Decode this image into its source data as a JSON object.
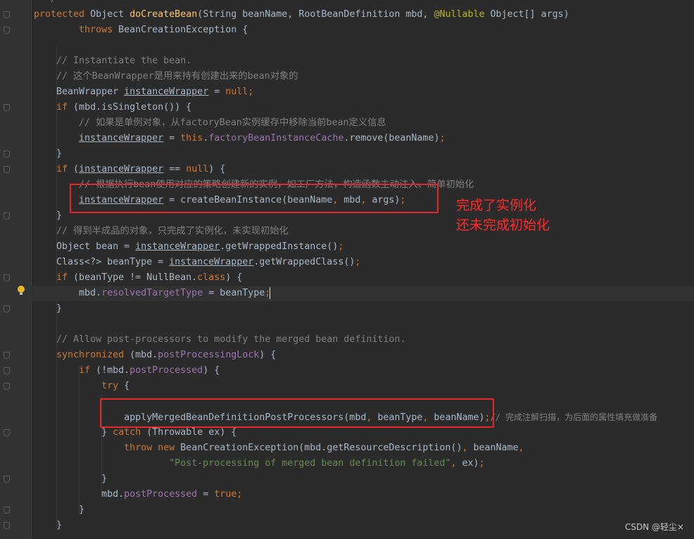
{
  "code": {
    "l0": "*/",
    "l1": [
      "protected",
      "Object",
      "doCreateBean",
      "(String beanName, RootBeanDefinition mbd, ",
      "@Nullable",
      " Object[] args)"
    ],
    "l2": [
      "throws",
      "BeanCreationException {"
    ],
    "l4": "// Instantiate the bean.",
    "l5": "// 这个BeanWrapper是用来持有创建出来的bean对象的",
    "l6": [
      "BeanWrapper ",
      "instanceWrapper",
      " = ",
      "null",
      ";"
    ],
    "l7": [
      "if",
      " (mbd.isSingleton()) {"
    ],
    "l8": "// 如果是单例对象，从factoryBean实例缓存中移除当前bean定义信息",
    "l9": [
      "instanceWrapper",
      " = ",
      "this",
      ".",
      "factoryBeanInstanceCache",
      ".remove(beanName)",
      ";"
    ],
    "l10": "}",
    "l11": [
      "if",
      " (",
      "instanceWrapper",
      " == ",
      "null",
      ") {"
    ],
    "l12": "// 根据执行bean使用对应的策略创建新的实例，如工厂方法，构造函数主动注入、简单初始化",
    "l13": [
      "instanceWrapper",
      " = createBeanInstance(beanName",
      ",",
      " mbd",
      ",",
      " args)",
      ";"
    ],
    "l14": "}",
    "l15": "// 得到半成品的对象，只完成了实例化，未实现初始化",
    "l16": [
      "Object bean = ",
      "instanceWrapper",
      ".getWrappedInstance()",
      ";"
    ],
    "l17": [
      "Class<?> beanType = ",
      "instanceWrapper",
      ".getWrappedClass()",
      ";"
    ],
    "l18": [
      "if",
      " (beanType != NullBean.",
      "class",
      ") {"
    ],
    "l19": [
      "mbd.",
      "resolvedTargetType",
      " = beanType",
      ";"
    ],
    "l20": "}",
    "l22": "// Allow post-processors to modify the merged bean definition.",
    "l23": [
      "synchronized",
      " (mbd.",
      "postProcessingLock",
      ") {"
    ],
    "l24": [
      "if",
      " (!mbd.",
      "postProcessed",
      ") {"
    ],
    "l25": [
      "try",
      " {"
    ],
    "l27": [
      "applyMergedBeanDefinitionPostProcessors(mbd",
      ",",
      " beanType",
      ",",
      " beanName)",
      ";",
      "// 完成注解扫描，为后面的属性填充做准备"
    ],
    "l28": [
      "} ",
      "catch",
      " (Throwable ex) {"
    ],
    "l29": [
      "throw",
      "new",
      " BeanCreationException(mbd.getResourceDescription()",
      ",",
      " beanName",
      ","
    ],
    "l30": [
      "\"Post-processing of merged bean definition failed\"",
      ",",
      " ex)",
      ";"
    ],
    "l31": "}",
    "l32": [
      "mbd.",
      "postProcessed",
      " = ",
      "true",
      ";"
    ],
    "l33": "}",
    "l34": "}"
  },
  "annotations": {
    "note1": "完成了实例化",
    "note2": "还未完成初始化"
  },
  "watermark": "CSDN @轻尘×",
  "colors": {
    "background": "#2b2b2b",
    "keyword": "#cc7832",
    "method_decl": "#ffc66d",
    "field": "#9876aa",
    "string": "#6a8759",
    "comment": "#808080",
    "annotation": "#bbb529",
    "highlight_box": "#e8262a"
  },
  "icons": {
    "intention_bulb": "lightbulb-icon",
    "fold_marker": "fold-marker-icon"
  }
}
